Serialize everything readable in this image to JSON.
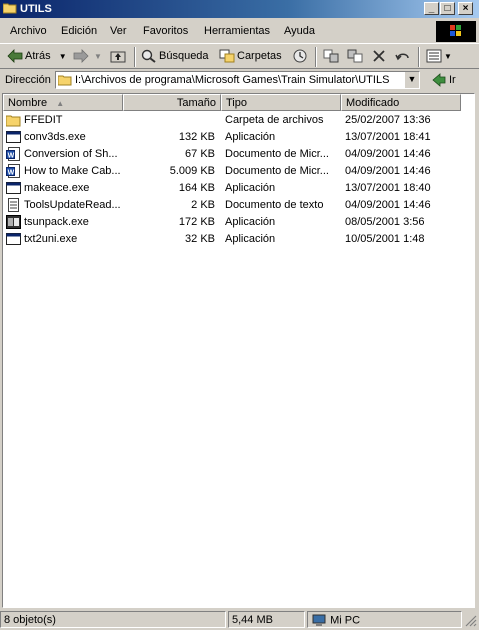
{
  "window": {
    "title": "UTILS",
    "minimize": "_",
    "maximize": "□",
    "close": "×"
  },
  "menu": [
    "Archivo",
    "Edición",
    "Ver",
    "Favoritos",
    "Herramientas",
    "Ayuda"
  ],
  "toolbar": {
    "back": "Atrás",
    "search": "Búsqueda",
    "folders": "Carpetas"
  },
  "address": {
    "label": "Dirección",
    "path": "I:\\Archivos de programa\\Microsoft Games\\Train Simulator\\UTILS",
    "go": "Ir"
  },
  "columns": {
    "name": "Nombre",
    "size": "Tamaño",
    "type": "Tipo",
    "modified": "Modificado"
  },
  "files": [
    {
      "name": "FFEDIT",
      "size": "",
      "type": "Carpeta de archivos",
      "modified": "25/02/2007 13:36",
      "icon": "folder-icon"
    },
    {
      "name": "conv3ds.exe",
      "size": "132 KB",
      "type": "Aplicación",
      "modified": "13/07/2001 18:41",
      "icon": "application-icon"
    },
    {
      "name": "Conversion of Sh...",
      "size": "67 KB",
      "type": "Documento de Micr...",
      "modified": "04/09/2001 14:46",
      "icon": "word-document-icon"
    },
    {
      "name": "How to Make Cab...",
      "size": "5.009 KB",
      "type": "Documento de Micr...",
      "modified": "04/09/2001 14:46",
      "icon": "word-document-icon"
    },
    {
      "name": "makeace.exe",
      "size": "164 KB",
      "type": "Aplicación",
      "modified": "13/07/2001 18:40",
      "icon": "application-icon"
    },
    {
      "name": "ToolsUpdateRead...",
      "size": "2 KB",
      "type": "Documento de texto",
      "modified": "04/09/2001 14:46",
      "icon": "text-document-icon"
    },
    {
      "name": "tsunpack.exe",
      "size": "172 KB",
      "type": "Aplicación",
      "modified": "08/05/2001 3:56",
      "icon": "tsunpack-icon"
    },
    {
      "name": "txt2uni.exe",
      "size": "32 KB",
      "type": "Aplicación",
      "modified": "10/05/2001 1:48",
      "icon": "application-icon"
    }
  ],
  "status": {
    "count": "8 objeto(s)",
    "size": "5,44 MB",
    "location": "Mi PC"
  }
}
